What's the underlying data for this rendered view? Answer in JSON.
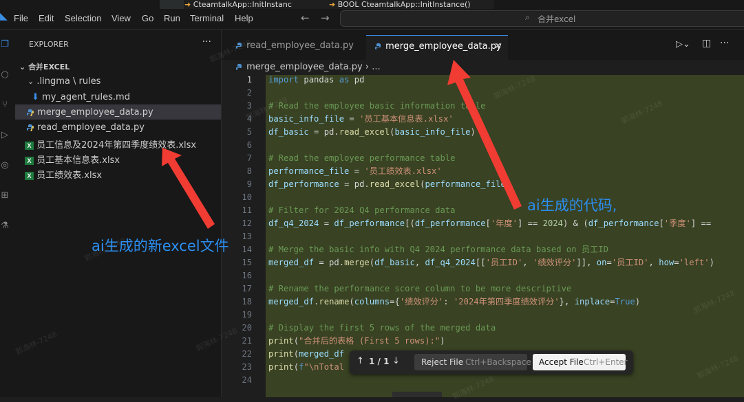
{
  "top_tabs": [
    "CteamtalkApp::InitInstanc",
    "BOOL CteamtalkApp::InitInstance()"
  ],
  "menu": [
    "File",
    "Edit",
    "Selection",
    "View",
    "Go",
    "Run",
    "Terminal",
    "Help"
  ],
  "search": {
    "text": "合并excel"
  },
  "explorer": {
    "title": "EXPLORER",
    "root": "合并EXCEL",
    "items": [
      {
        "label": ".lingma \\ rules",
        "kind": "folder"
      },
      {
        "label": "my_agent_rules.md",
        "kind": "md"
      },
      {
        "label": "merge_employee_data.py",
        "kind": "py"
      },
      {
        "label": "read_employee_data.py",
        "kind": "py"
      },
      {
        "label": "员工信息及2024年第四季度绩效表.xlsx",
        "kind": "xlsx"
      },
      {
        "label": "员工基本信息表.xlsx",
        "kind": "xlsx"
      },
      {
        "label": "员工绩效表.xlsx",
        "kind": "xlsx"
      }
    ]
  },
  "tabs": [
    {
      "label": "read_employee_data.py",
      "active": false
    },
    {
      "label": "merge_employee_data.py",
      "active": true
    }
  ],
  "breadcrumb": [
    "merge_employee_data.py",
    "..."
  ],
  "code": {
    "line_numbers": [
      "1",
      "2",
      "3",
      "4",
      "5",
      "6",
      "7",
      "8",
      "9",
      "10",
      "11",
      "12",
      "13",
      "14",
      "15",
      "16",
      "17",
      "18",
      "19",
      "20",
      "21",
      "22",
      "23",
      "24"
    ]
  },
  "diff_bar": {
    "counter": "1 / 1",
    "reject": "Reject File",
    "reject_key": "Ctrl+Backspace",
    "accept": "Accept File",
    "accept_key": "Ctrl+Enter"
  },
  "annotations": {
    "new_file": "ai生成的新excel文件",
    "code": "ai生成的代码,"
  },
  "watermark": "郭海林-7248",
  "colors": {
    "accent": "#2b8ef0",
    "arrow": "#f03c32",
    "diff_bg": "#394223"
  }
}
